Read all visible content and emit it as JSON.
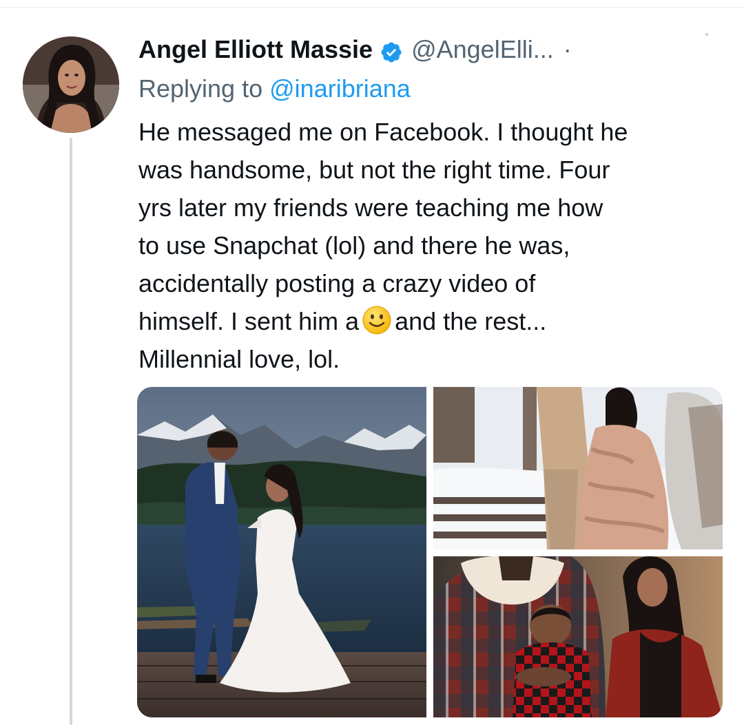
{
  "tweet": {
    "display_name": "Angel Elliott Massie",
    "verified_icon": "verified-badge-icon",
    "handle": "@AngelElli...",
    "separator": "·",
    "reply_prefix": "Replying to",
    "reply_to": "@inaribriana",
    "text_lines": [
      "He messaged me on Facebook. I thought he",
      "was handsome, but not the right time. Four",
      "yrs later my friends were teaching me how",
      "to use Snapchat (lol) and there he was,",
      "accidentally posting a crazy video of"
    ],
    "line6_before": "himself. I sent him a",
    "emoji": "slightly-smiling-face-emoji",
    "line6_after": "and the rest...",
    "line7": "Millennial love, lol."
  },
  "colors": {
    "verified": "#1d9bf0",
    "link": "#1d9bf0",
    "secondary_text": "#536471",
    "primary_text": "#0f1419",
    "thread_line": "#cfd9de"
  },
  "media": {
    "photo_count": 3,
    "photos": [
      "wedding-lake-photo",
      "snow-maternity-photo",
      "family-plaid-photo"
    ]
  }
}
